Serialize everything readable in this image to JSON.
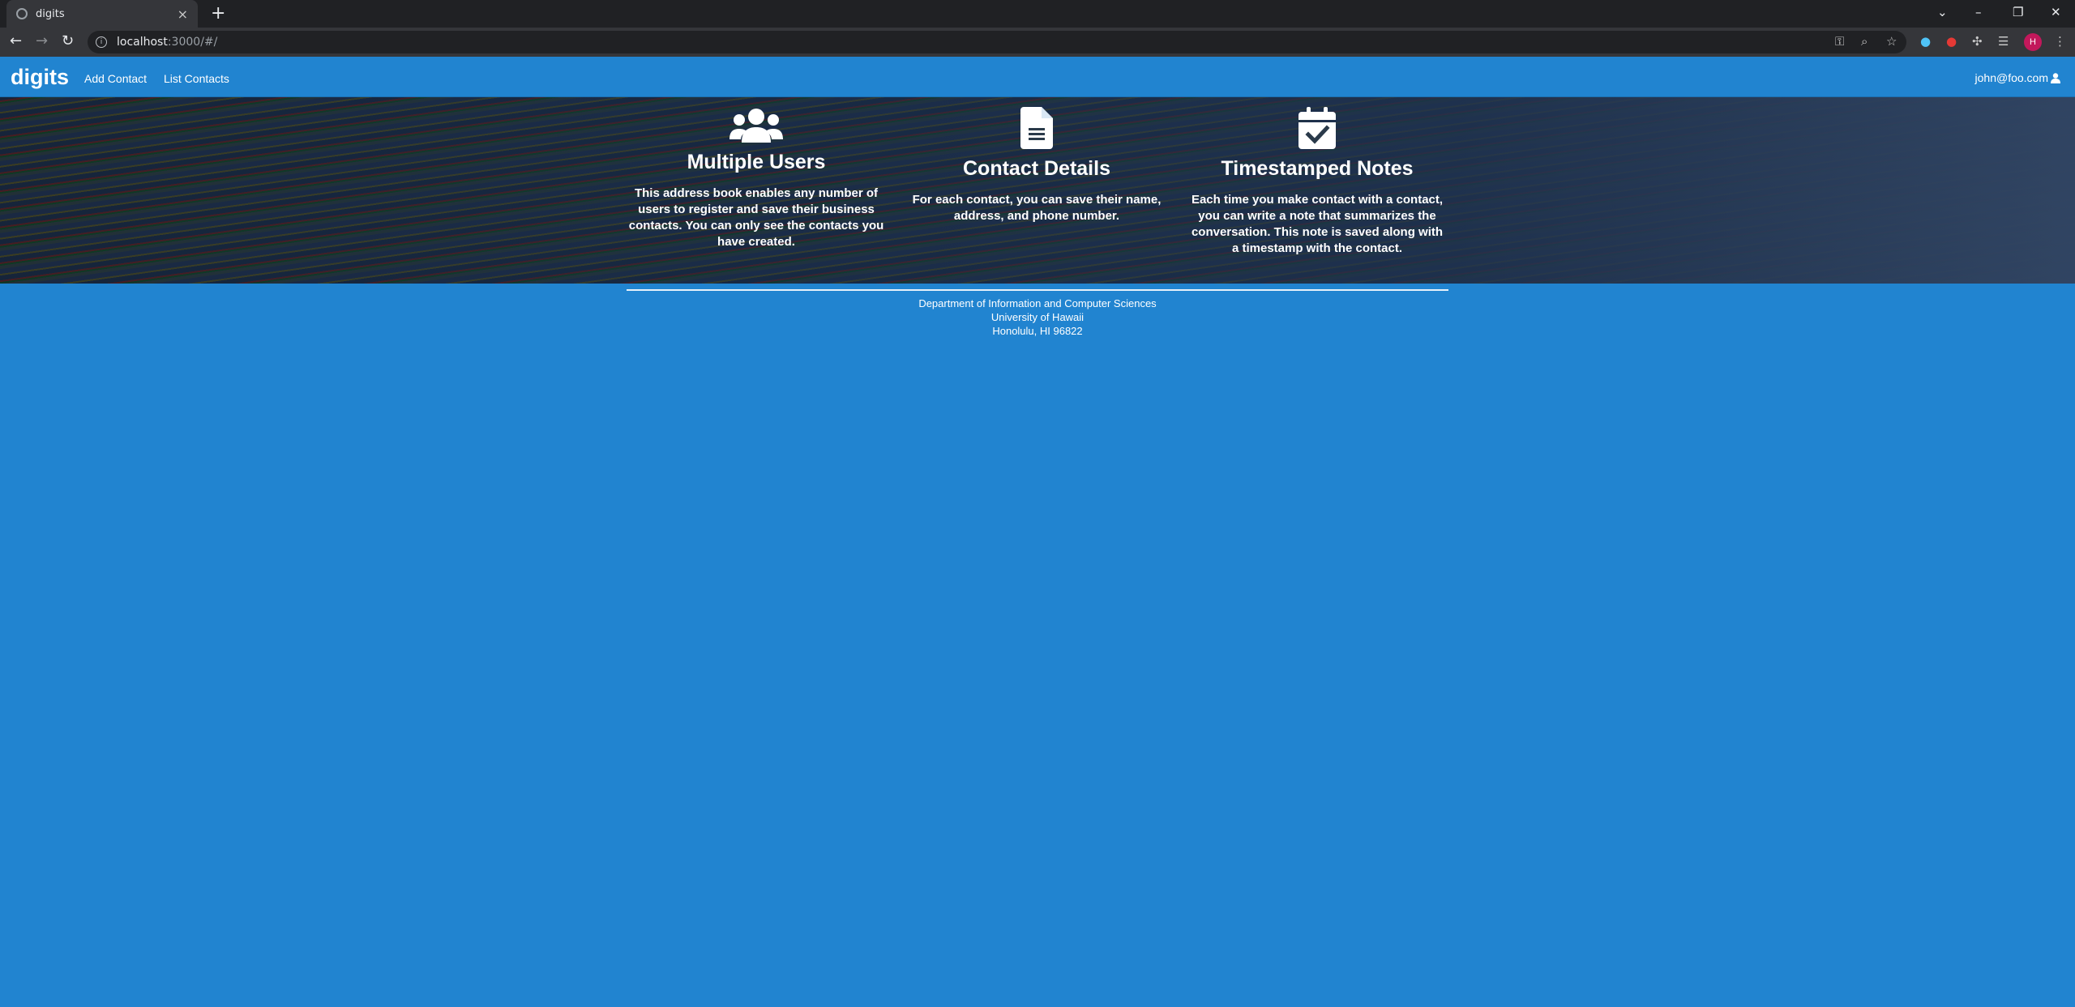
{
  "browser": {
    "tab_title": "digits",
    "tab_close": "×",
    "new_tab": "+",
    "url_host": "localhost",
    "url_path": ":3000/#/",
    "controls": {
      "minimize": "–",
      "restore": "❐",
      "close": "✕",
      "tabsearch": "⌄"
    },
    "profile_initial": "H"
  },
  "navbar": {
    "brand": "digits",
    "links": [
      "Add Contact",
      "List Contacts"
    ],
    "user": "john@foo.com"
  },
  "features": [
    {
      "icon": "users-icon",
      "title": "Multiple Users",
      "text": "This address book enables any number of users to register and save their business contacts. You can only see the contacts you have created."
    },
    {
      "icon": "file-text-icon",
      "title": "Contact Details",
      "text": "For each contact, you can save their name, address, and phone number."
    },
    {
      "icon": "calendar-check-icon",
      "title": "Timestamped Notes",
      "text": "Each time you make contact with a contact, you can write a note that summarizes the conversation. This note is saved along with a timestamp with the contact."
    }
  ],
  "footer": {
    "line1": "Department of Information and Computer Sciences",
    "line2": "University of Hawaii",
    "line3": "Honolulu, HI 96822"
  },
  "colors": {
    "page_background": "#2184d0",
    "browser_dark": "#202124",
    "browser_toolbar": "#35363a"
  }
}
